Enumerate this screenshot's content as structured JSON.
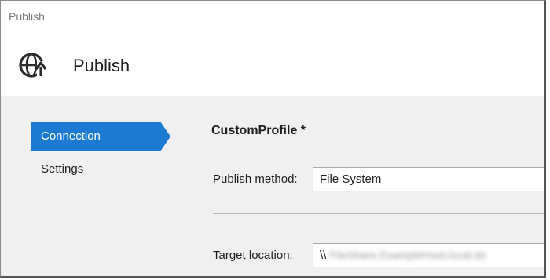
{
  "window": {
    "title": "Publish"
  },
  "header": {
    "title": "Publish",
    "icon": "globe-publish-icon"
  },
  "nav": {
    "items": [
      {
        "label": "Connection",
        "active": true
      },
      {
        "label": "Settings",
        "active": false
      }
    ]
  },
  "main": {
    "profile_name": "CustomProfile *",
    "publish_method": {
      "label_pre": "Publish ",
      "label_mnemonic": "m",
      "label_post": "ethod:",
      "value": "File System"
    },
    "target_location": {
      "label_mnemonic": "T",
      "label_post": "arget location:",
      "value_prefix": "\\\\",
      "value_redacted": "FileShare.ExampleHost.local.de"
    }
  },
  "colors": {
    "accent": "#1c7ad3",
    "background": "#f0f0f0"
  }
}
